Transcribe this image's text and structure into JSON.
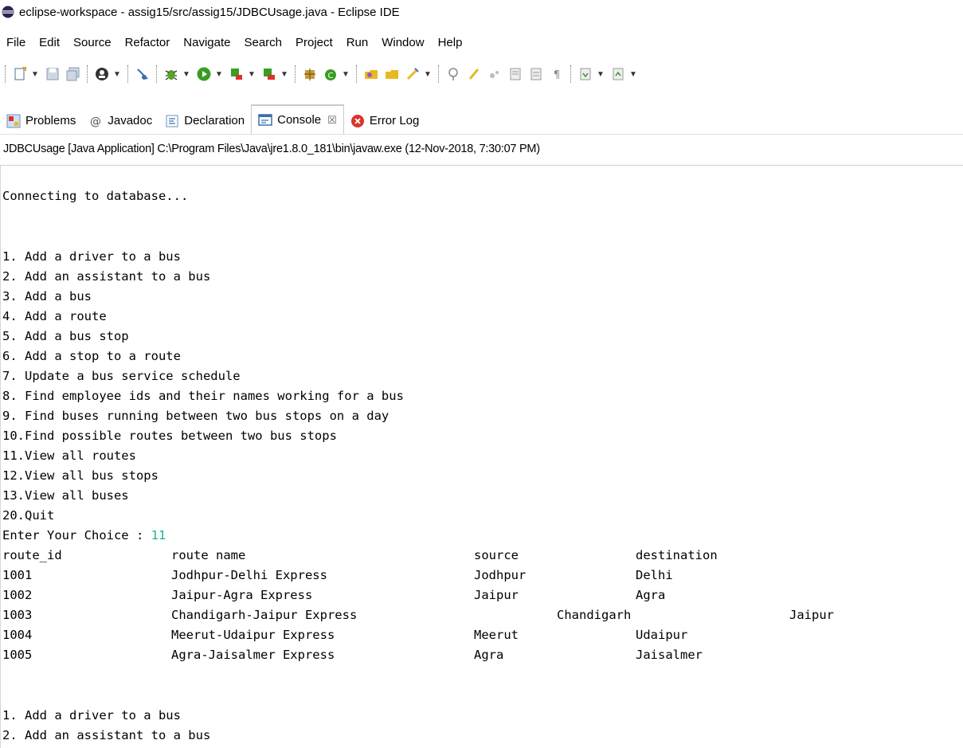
{
  "window": {
    "title": "eclipse-workspace - assig15/src/assig15/JDBCUsage.java - Eclipse IDE"
  },
  "menubar": {
    "items": [
      "File",
      "Edit",
      "Source",
      "Refactor",
      "Navigate",
      "Search",
      "Project",
      "Run",
      "Window",
      "Help"
    ]
  },
  "toolbar": {
    "buttons": [
      "new-icon",
      "save-icon",
      "save-all-icon",
      "profile-icon",
      "skip-breakpoints-icon",
      "debug-icon",
      "run-icon",
      "coverage-icon",
      "external-tools-icon",
      "new-java-package-icon",
      "new-java-class-icon",
      "open-type-icon",
      "open-task-icon",
      "search-icon",
      "annotation-icon",
      "mark-occurrences-icon",
      "block-selection-icon",
      "word-wrap-icon",
      "show-whitespace-icon",
      "next-annotation-icon",
      "prev-annotation-icon"
    ]
  },
  "tabs": [
    {
      "label": "Problems",
      "icon": "problems-icon",
      "active": false
    },
    {
      "label": "Javadoc",
      "icon": "javadoc-icon",
      "active": false
    },
    {
      "label": "Declaration",
      "icon": "declaration-icon",
      "active": false
    },
    {
      "label": "Console",
      "icon": "console-icon",
      "active": true,
      "close": "☒"
    },
    {
      "label": "Error Log",
      "icon": "error-log-icon",
      "active": false
    }
  ],
  "console": {
    "header": "JDBCUsage [Java Application] C:\\Program Files\\Java\\jre1.8.0_181\\bin\\javaw.exe (12-Nov-2018, 7:30:07 PM)",
    "connecting": "Connecting to database...",
    "menu": [
      "1. Add a driver to a bus",
      "2. Add an assistant to a bus",
      "3. Add a bus",
      "4. Add a route",
      "5. Add a bus stop",
      "6. Add a stop to a route",
      "7. Update a bus service schedule",
      "8. Find employee ids and their names working for a bus",
      "9. Find buses running between two bus stops on a day",
      "10.Find possible routes between two bus stops",
      "11.View all routes",
      "12.View all bus stops",
      "13.View all buses",
      "20.Quit"
    ],
    "prompt": "Enter Your Choice : ",
    "choice": "11",
    "routes_header": [
      "route_id",
      "route name",
      "source",
      "destination"
    ],
    "routes": [
      [
        "1001",
        "Jodhpur-Delhi Express",
        "Jodhpur",
        "Delhi"
      ],
      [
        "1002",
        "Jaipur-Agra Express",
        "Jaipur",
        "Agra"
      ],
      [
        "1003",
        "Chandigarh-Jaipur Express",
        "Chandigarh",
        "Jaipur"
      ],
      [
        "1004",
        "Meerut-Udaipur Express",
        "Meerut",
        "Udaipur"
      ],
      [
        "1005",
        "Agra-Jaisalmer Express",
        "Agra",
        "Jaisalmer"
      ]
    ],
    "menu_repeat": [
      "1. Add a driver to a bus",
      "2. Add an assistant to a bus"
    ]
  },
  "colors": {
    "input_echo": "#1ab292",
    "tab_border": "#c9c9c9"
  }
}
